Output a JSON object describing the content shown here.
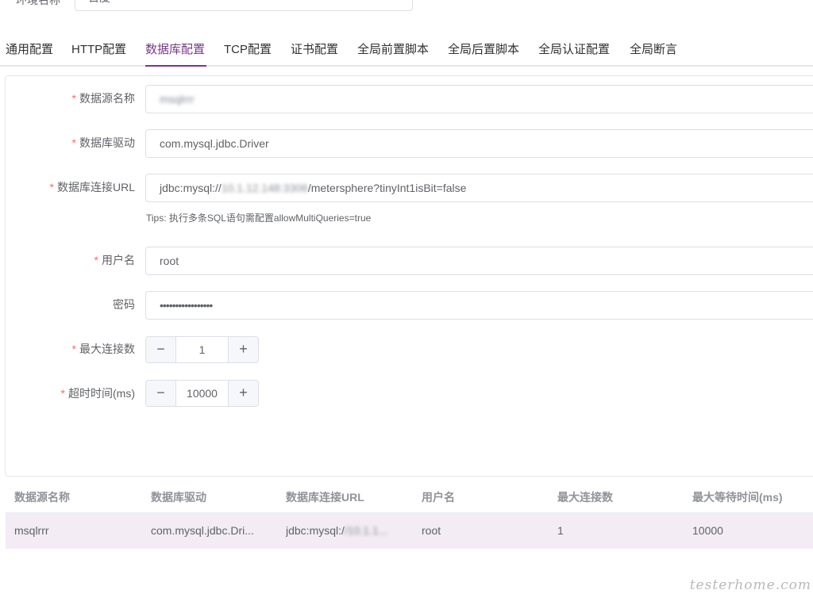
{
  "env": {
    "label": "环境名称",
    "value": "百度"
  },
  "tabs": [
    {
      "label": "通用配置"
    },
    {
      "label": "HTTP配置"
    },
    {
      "label": "数据库配置"
    },
    {
      "label": "TCP配置"
    },
    {
      "label": "证书配置"
    },
    {
      "label": "全局前置脚本"
    },
    {
      "label": "全局后置脚本"
    },
    {
      "label": "全局认证配置"
    },
    {
      "label": "全局断言"
    }
  ],
  "form": {
    "required_mark": "*",
    "datasource_name": {
      "label": "数据源名称",
      "value": "msqlrrr"
    },
    "driver": {
      "label": "数据库驱动",
      "value": "com.mysql.jdbc.Driver"
    },
    "url": {
      "label": "数据库连接URL",
      "prefix": "jdbc:mysql://",
      "masked": "10.1.12.148:3306",
      "suffix": "/metersphere?tinyInt1isBit=false",
      "tips": "Tips: 执行多条SQL语句需配置allowMultiQueries=true"
    },
    "username": {
      "label": "用户名",
      "value": "root"
    },
    "password": {
      "label": "密码",
      "value": "•••••••••••••••••"
    },
    "max_connections": {
      "label": "最大连接数",
      "value": "1",
      "minus": "−",
      "plus": "+"
    },
    "timeout": {
      "label": "超时时间(ms)",
      "value": "10000",
      "minus": "−",
      "plus": "+"
    }
  },
  "table": {
    "columns": [
      "数据源名称",
      "数据库驱动",
      "数据库连接URL",
      "用户名",
      "最大连接数",
      "最大等待时间(ms)"
    ],
    "rows": [
      {
        "name": "msqlrrr",
        "driver": "com.mysql.jdbc.Dri...",
        "url_prefix": "jdbc:mysql:/",
        "url_masked": "/10.1.1...",
        "username": "root",
        "max_connections": "1",
        "max_wait": "10000"
      }
    ]
  },
  "watermark": "testerhome.com",
  "colors": {
    "accent": "#783887",
    "required": "#f56c6c",
    "row_highlight": "#f3ecf4"
  }
}
